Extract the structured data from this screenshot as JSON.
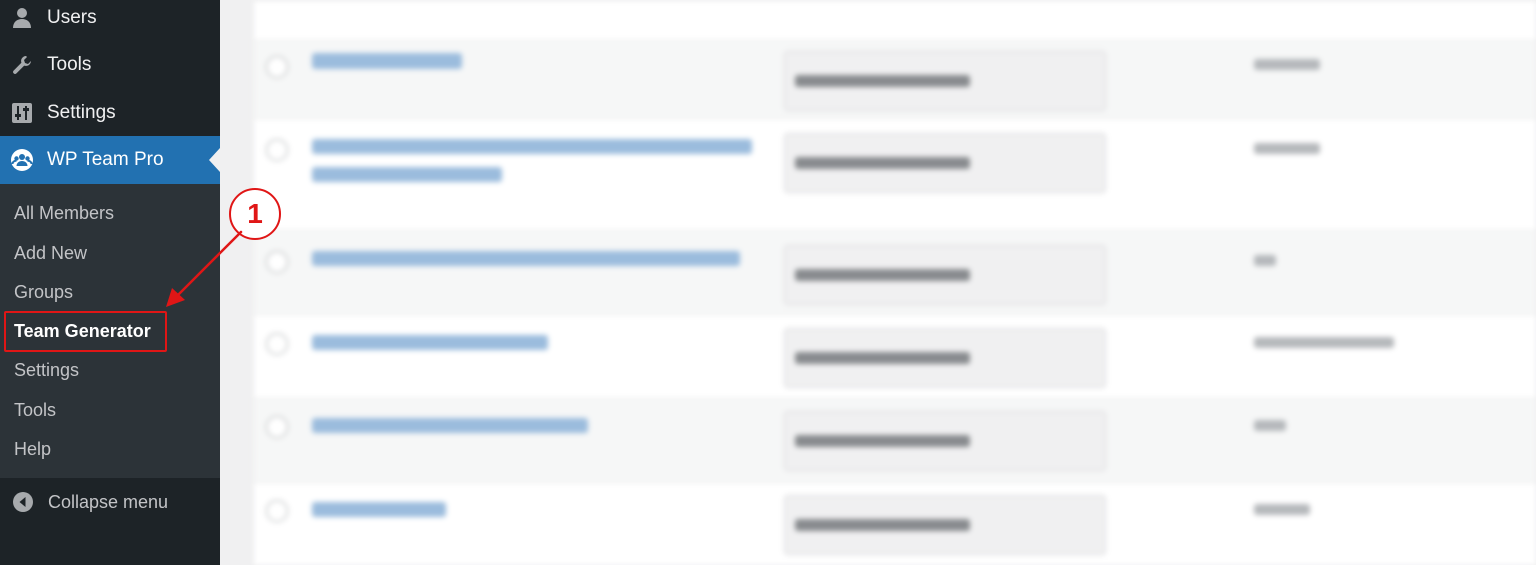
{
  "sidebar": {
    "top_items": [
      {
        "label": "Users",
        "icon": "user-icon"
      },
      {
        "label": "Tools",
        "icon": "wrench-icon"
      },
      {
        "label": "Settings",
        "icon": "settings-sliders-icon"
      },
      {
        "label": "WP Team Pro",
        "icon": "team-icon",
        "active": true
      }
    ],
    "submenu": [
      {
        "label": "All Members"
      },
      {
        "label": "Add New"
      },
      {
        "label": "Groups"
      },
      {
        "label": "Team Generator",
        "current": true
      },
      {
        "label": "Settings"
      },
      {
        "label": "Tools"
      },
      {
        "label": "Help"
      }
    ],
    "collapse_label": "Collapse menu"
  },
  "annotation": {
    "step_number": "1",
    "color": "#e01616"
  },
  "colors": {
    "sidebar_bg": "#1d2327",
    "submenu_bg": "#2c3338",
    "active_bg": "#2271b1",
    "link": "#2271b1"
  }
}
